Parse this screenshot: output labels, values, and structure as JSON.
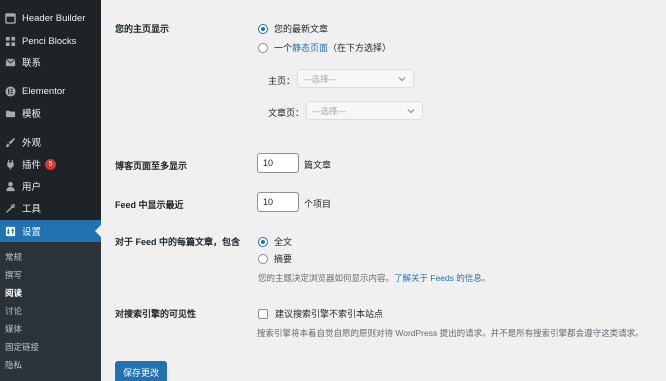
{
  "sidebar": {
    "items": [
      {
        "label": "Header Builder",
        "icon": "header-builder-icon"
      },
      {
        "label": "Penci Blocks",
        "icon": "blocks-icon"
      },
      {
        "label": "联系",
        "icon": "mail-icon"
      },
      {
        "label": "Elementor",
        "icon": "elementor-icon"
      },
      {
        "label": "模板",
        "icon": "folder-icon"
      },
      {
        "label": "外观",
        "icon": "paintbrush-icon"
      },
      {
        "label": "插件",
        "icon": "plugin-icon",
        "badge": "5"
      },
      {
        "label": "用户",
        "icon": "user-icon"
      },
      {
        "label": "工具",
        "icon": "wrench-icon"
      },
      {
        "label": "设置",
        "icon": "settings-icon"
      }
    ],
    "submenu": [
      "常规",
      "撰写",
      "阅读",
      "讨论",
      "媒体",
      "固定链接",
      "隐私"
    ],
    "current_submenu": "阅读"
  },
  "front_page": {
    "label": "您的主页显示",
    "option_latest": "您的最新文章",
    "option_static_prefix": "一个",
    "option_static_link": "静态页面",
    "option_static_suffix": "（在下方选择）",
    "homepage_label": "主页：",
    "homepage_select": "—选择—",
    "posts_page_label": "文章页：",
    "posts_page_select": "—选择—"
  },
  "posts_per_page": {
    "label": "博客页面至多显示",
    "value": "10",
    "unit": "篇文章"
  },
  "feed_items": {
    "label": "Feed 中显示最近",
    "value": "10",
    "unit": "个项目"
  },
  "feed_content": {
    "label": "对于 Feed 中的每篇文章，包含",
    "option_full": "全文",
    "option_summary": "摘要",
    "desc_prefix": "您的主题决定浏览器如何显示内容。",
    "desc_link": "了解关于 Feeds 的信息",
    "desc_suffix": "。"
  },
  "search_visibility": {
    "label": "对搜索引擎的可见性",
    "checkbox_label": "建议搜索引擎不索引本站点",
    "desc": "搜索引擎将本着自觉自愿的原则对待 WordPress 提出的请求。并不是所有搜索引擎都会遵守这类请求。"
  },
  "save_button": "保存更改",
  "colors": {
    "accent": "#2271b1",
    "sidebar": "#1d2327",
    "badge": "#d63638"
  }
}
